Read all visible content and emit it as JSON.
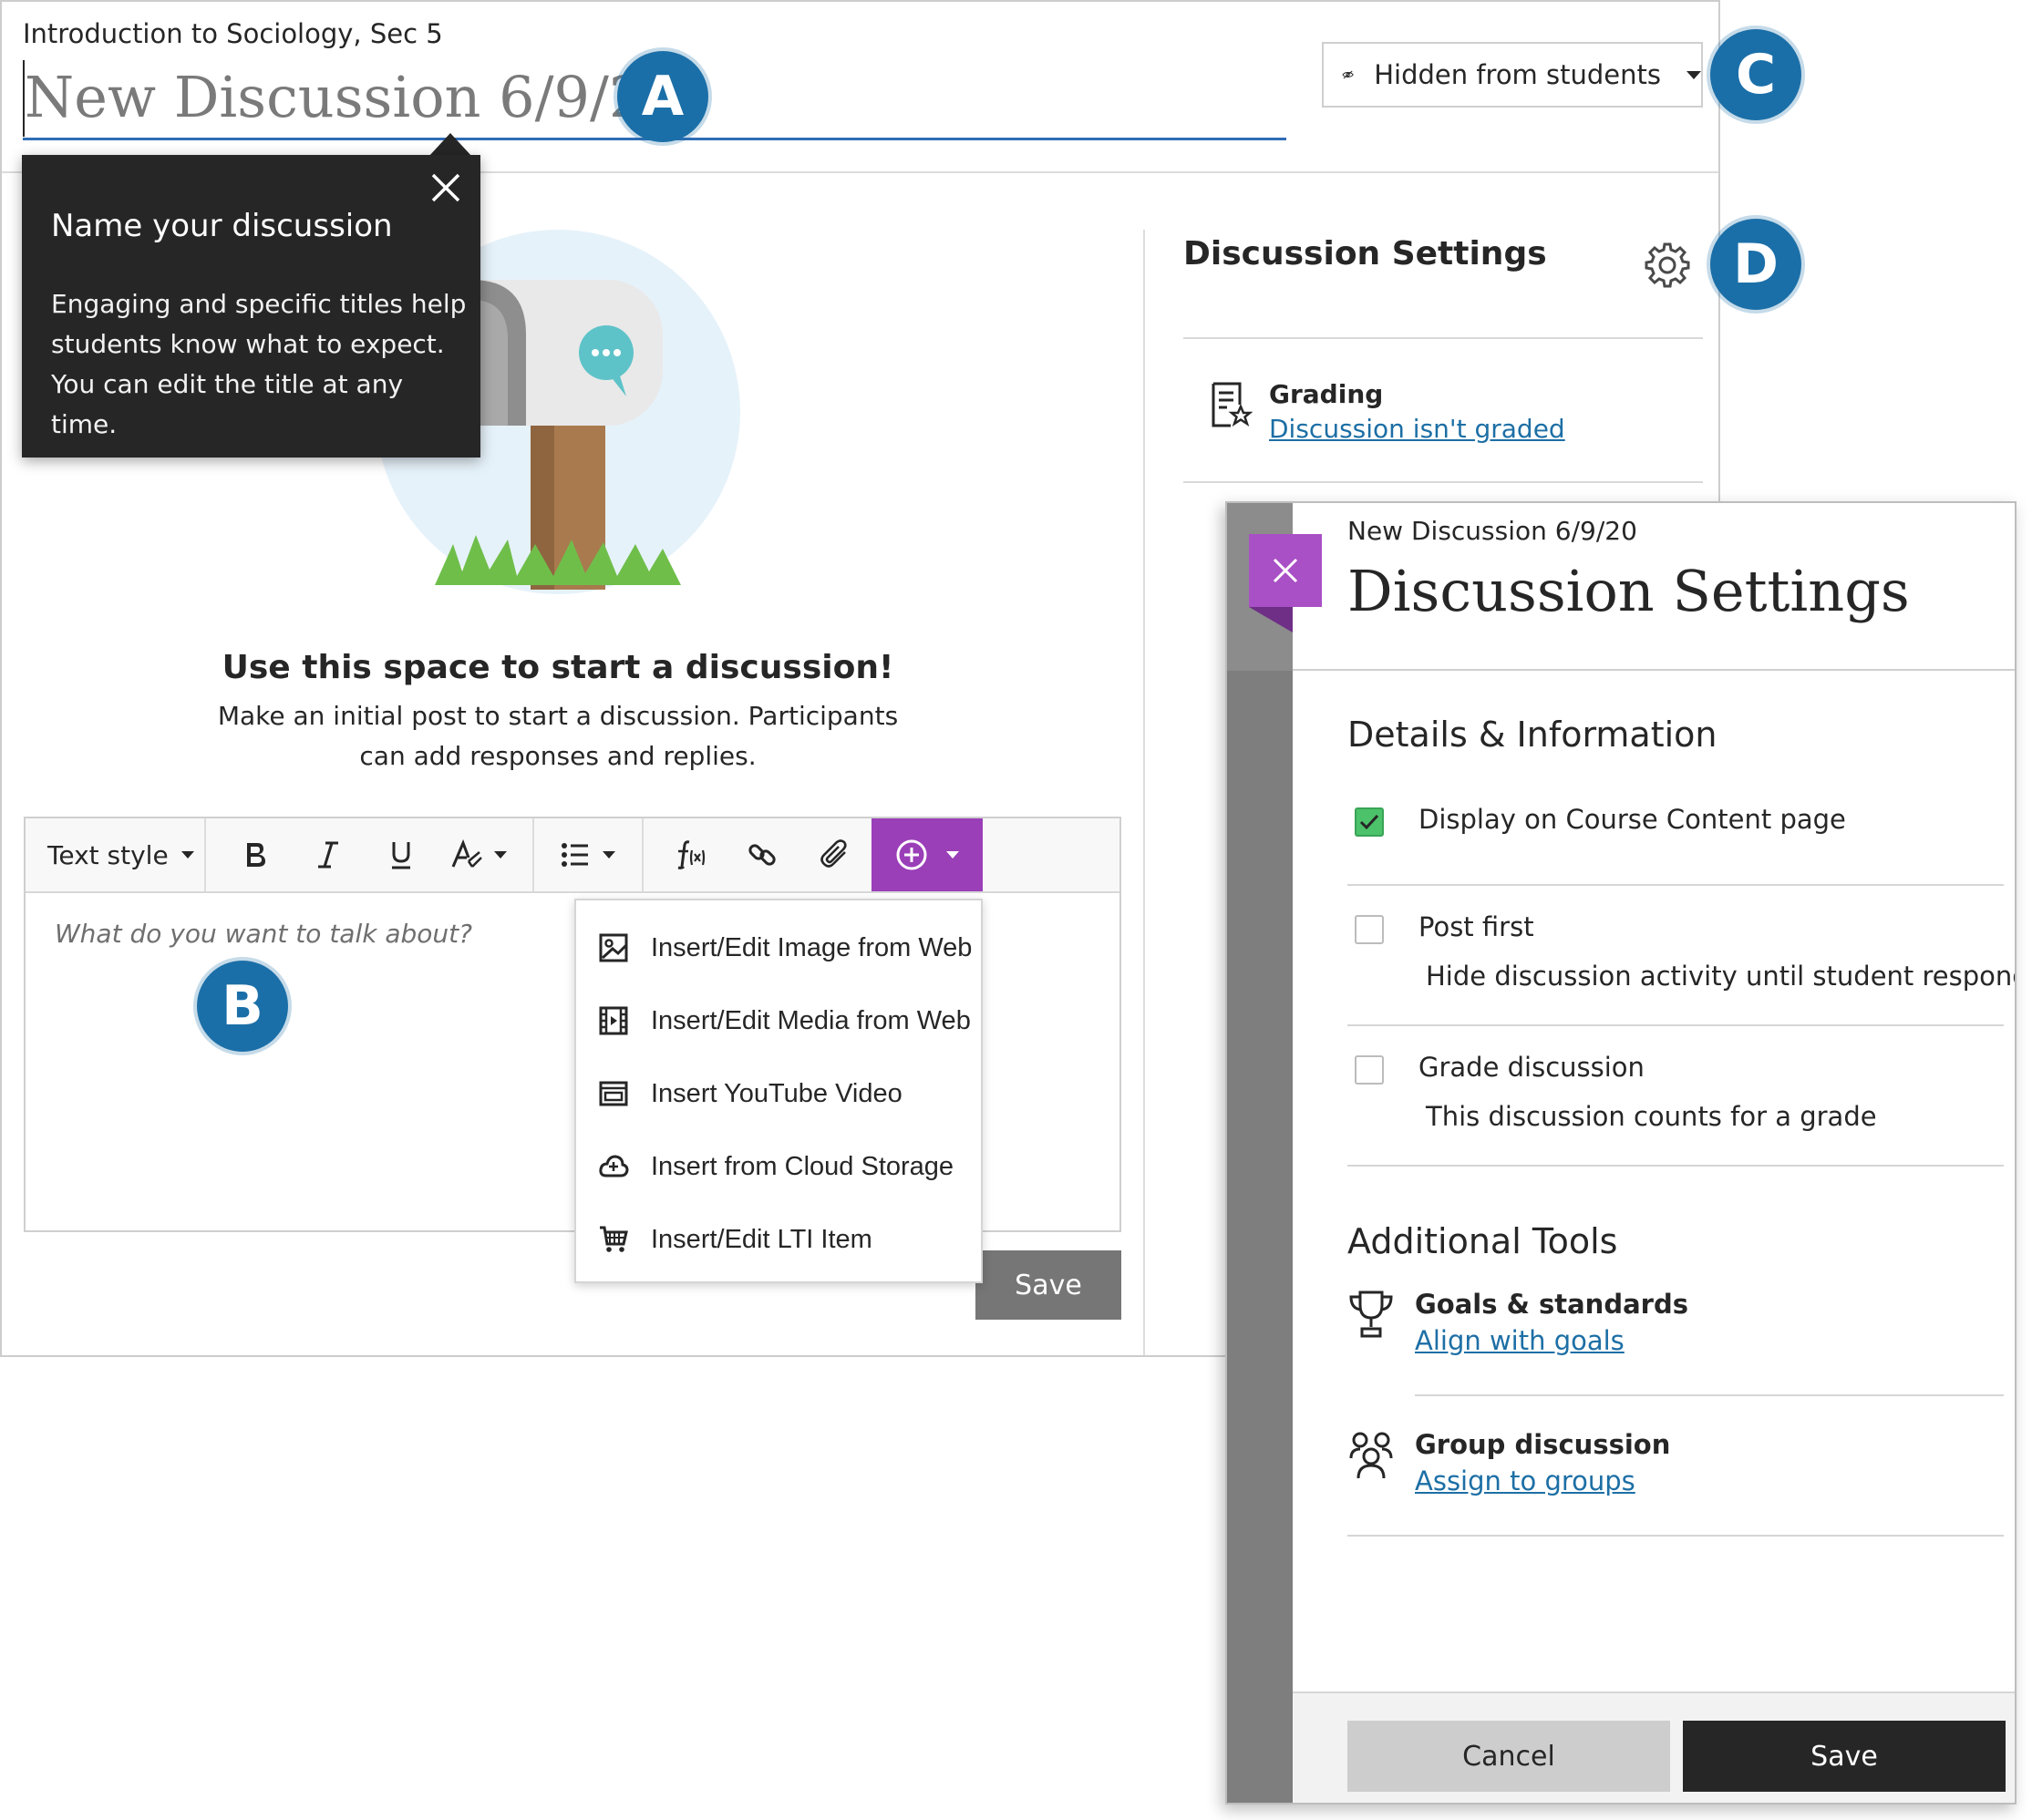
{
  "course": {
    "name": "Introduction to Sociology, Sec 5"
  },
  "title_field": {
    "placeholder": "New Discussion 6/9/20"
  },
  "visibility": {
    "label": "Hidden from students"
  },
  "badges": {
    "a": "A",
    "b": "B",
    "c": "C",
    "d": "D",
    "badge_color": "#1b6fa8"
  },
  "tooltip": {
    "title": "Name your discussion",
    "body": "Engaging and specific titles help students know what to expect. You can edit the title at any time."
  },
  "empty_state": {
    "heading": "Use this space to start a discussion!",
    "body": "Make an initial post to start a discussion. Participants can add responses and replies."
  },
  "editor": {
    "text_style_label": "Text style",
    "placeholder": "What do you want to talk about?",
    "toolbar_icons": [
      "bold-icon",
      "italic-icon",
      "underline-icon",
      "text-format-icon",
      "list-icon",
      "math-formula-icon",
      "link-icon",
      "attachment-icon",
      "insert-content-icon"
    ],
    "insert_menu": [
      {
        "label": "Insert/Edit Image from Web",
        "icon": "image-icon"
      },
      {
        "label": "Insert/Edit Media from Web",
        "icon": "media-icon"
      },
      {
        "label": "Insert YouTube Video",
        "icon": "youtube-icon"
      },
      {
        "label": "Insert from Cloud Storage",
        "icon": "cloud-storage-icon"
      },
      {
        "label": "Insert/Edit LTI Item",
        "icon": "lti-cart-icon"
      }
    ],
    "save_label": "Save",
    "accent_color": "#9a3fb8"
  },
  "settings_column": {
    "title": "Discussion Settings",
    "grading_label": "Grading",
    "grading_link": "Discussion isn't graded"
  },
  "settings_panel": {
    "subtitle": "New Discussion 6/9/20",
    "title": "Discussion Settings",
    "details_section": "Details & Information",
    "options": [
      {
        "label": "Display on Course Content page",
        "description": "",
        "checked": true
      },
      {
        "label": "Post first",
        "description": "Hide discussion activity until student responds",
        "checked": false
      },
      {
        "label": "Grade discussion",
        "description": "This discussion counts for a grade",
        "checked": false
      }
    ],
    "additional_section": "Additional Tools",
    "tools": [
      {
        "label": "Goals & standards",
        "link": "Align with goals",
        "icon": "trophy-icon"
      },
      {
        "label": "Group discussion",
        "link": "Assign to groups",
        "icon": "group-icon"
      }
    ],
    "cancel_label": "Cancel",
    "save_label": "Save",
    "close_color": "#a950c6"
  }
}
